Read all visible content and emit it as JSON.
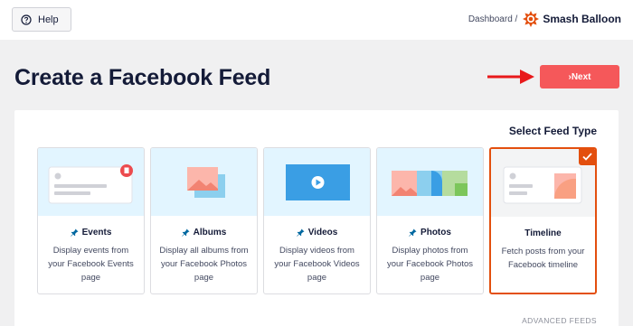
{
  "header": {
    "help_label": "Help",
    "breadcrumb_dashboard": "Dashboard /",
    "brand_name": "Smash Balloon"
  },
  "page": {
    "title": "Create a Facebook Feed",
    "next_label": "›Next"
  },
  "section": {
    "title": "Select Feed Type",
    "advanced_label": "ADVANCED FEEDS"
  },
  "feed_types": [
    {
      "label": "Events",
      "description": "Display events from your Facebook Events page",
      "icon": "pin-icon"
    },
    {
      "label": "Albums",
      "description": "Display all albums from your Facebook Photos page",
      "icon": "pin-icon"
    },
    {
      "label": "Videos",
      "description": "Display videos from your Facebook Videos page",
      "icon": "pin-icon"
    },
    {
      "label": "Photos",
      "description": "Display photos from your Facebook Photos page",
      "icon": "pin-icon"
    },
    {
      "label": "Timeline",
      "description": "Fetch posts from your Facebook timeline",
      "selected": true
    }
  ],
  "colors": {
    "accent_red": "#f5585a",
    "selected_orange": "#e34f0e",
    "thumb_blue": "#e2f5ff",
    "title": "#141b38"
  }
}
